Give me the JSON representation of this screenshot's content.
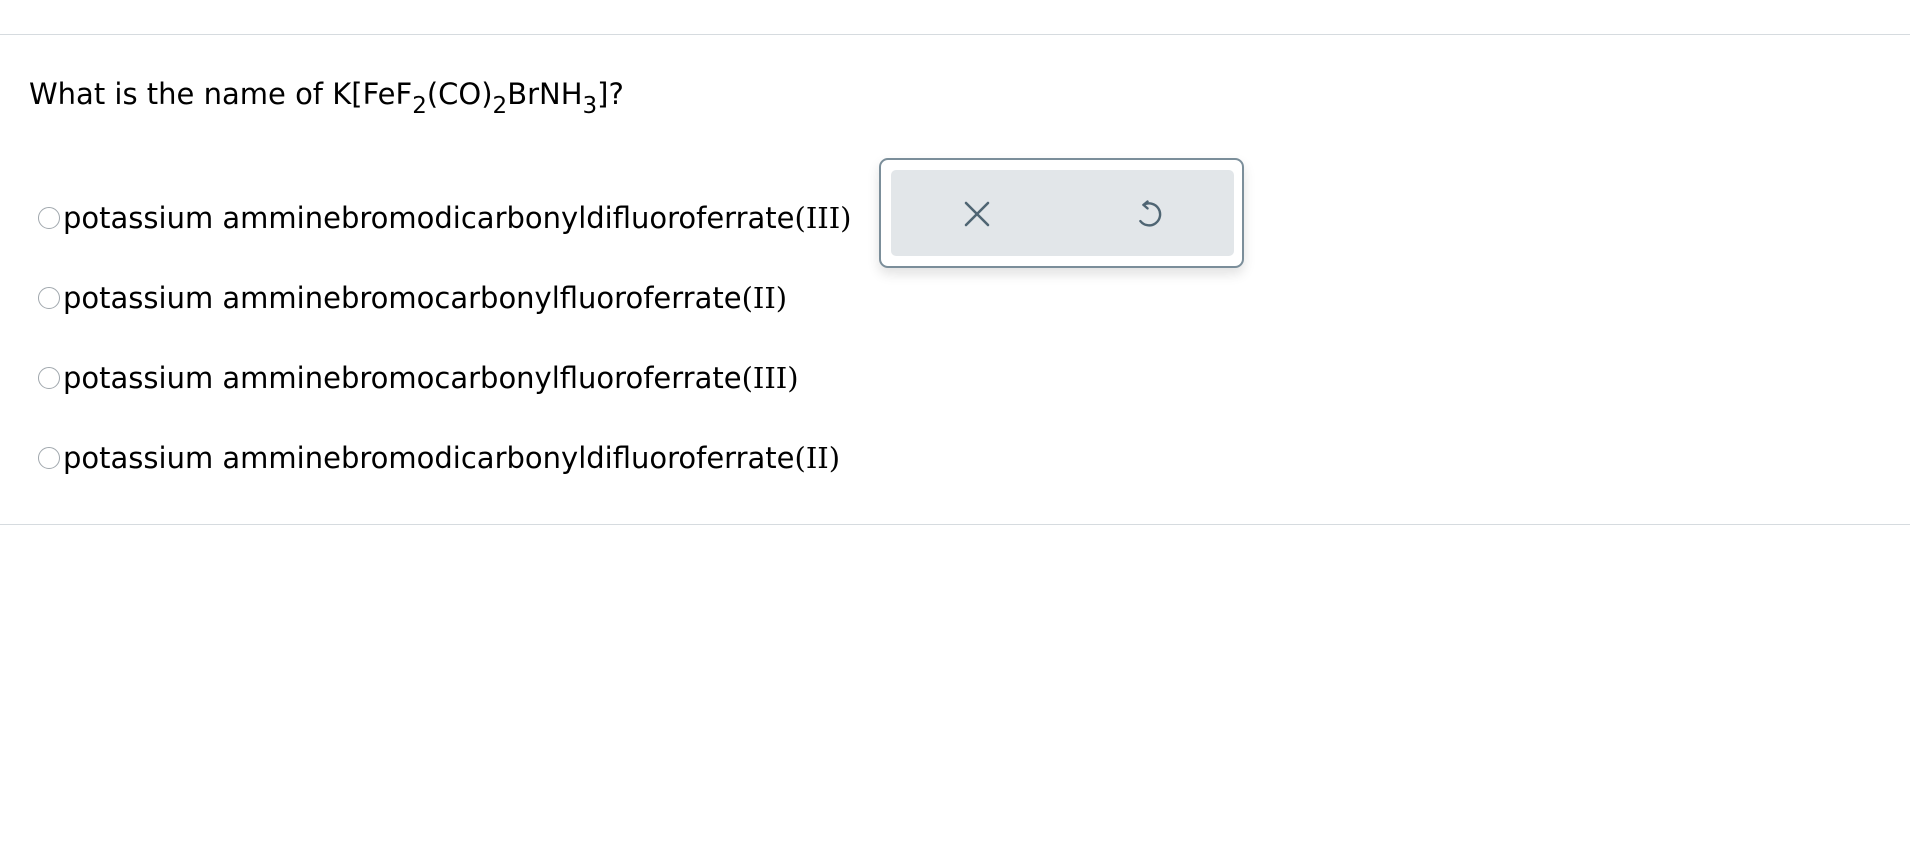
{
  "question": {
    "prefix": "What is the name of K[FeF",
    "sub1": "2",
    "mid1": "(CO)",
    "sub2": "2",
    "mid2": "BrNH",
    "sub3": "3",
    "suffix": "]?"
  },
  "options": [
    {
      "base": "potassium amminebromodicarbonyldifluoroferrate",
      "oxidation": "(III)"
    },
    {
      "base": "potassium amminebromocarbonylfluoroferrate",
      "oxidation": "(II)"
    },
    {
      "base": "potassium amminebromocarbonylfluoroferrate",
      "oxidation": "(III)"
    },
    {
      "base": "potassium amminebromodicarbonyldifluoroferrate",
      "oxidation": "(II)"
    }
  ],
  "toolbar": {
    "clear_icon": "close-icon",
    "reset_icon": "undo-icon"
  },
  "colors": {
    "icon": "#4f6573",
    "panel_border": "#7b8e9a",
    "panel_fill": "#e2e6e9",
    "rule": "#d6dbdf"
  }
}
